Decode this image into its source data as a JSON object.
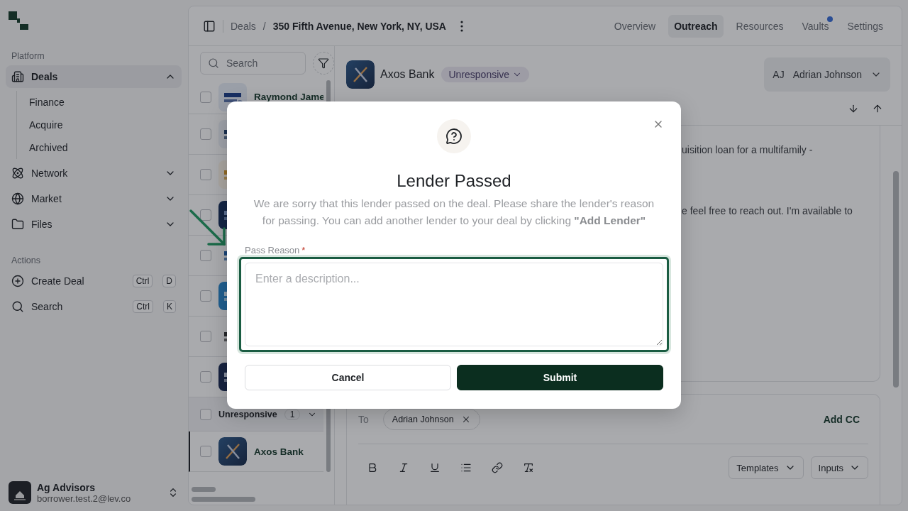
{
  "sidebar": {
    "sections": [
      {
        "title": "Platform",
        "items": [
          {
            "label": "Deals",
            "selected": true,
            "expanded": true,
            "children": [
              {
                "label": "Finance"
              },
              {
                "label": "Acquire"
              },
              {
                "label": "Archived"
              }
            ]
          },
          {
            "label": "Network",
            "selected": false,
            "expanded": false
          },
          {
            "label": "Market",
            "selected": false,
            "expanded": false
          },
          {
            "label": "Files",
            "selected": false,
            "expanded": false
          }
        ]
      },
      {
        "title": "Actions",
        "items": [
          {
            "label": "Create Deal",
            "shortcut": [
              "Ctrl",
              "D"
            ]
          },
          {
            "label": "Search",
            "shortcut": [
              "Ctrl",
              "K"
            ]
          }
        ]
      }
    ],
    "account": {
      "name": "Ag Advisors",
      "email": "borrower.test.2@lev.co"
    }
  },
  "breadcrumbs": [
    "Deals",
    "350 Fifth Avenue, New York, NY, USA"
  ],
  "breadcrumb_separator": "/",
  "tabs": [
    {
      "label": "Overview",
      "selected": false,
      "notification": false
    },
    {
      "label": "Outreach",
      "selected": true,
      "notification": false
    },
    {
      "label": "Resources",
      "selected": false,
      "notification": false
    },
    {
      "label": "Vaults",
      "selected": false,
      "notification": true
    },
    {
      "label": "Settings",
      "selected": false,
      "notification": false
    }
  ],
  "lender_list": {
    "search": {
      "placeholder": "Search"
    },
    "rows": [
      {
        "kind": "lender",
        "name": "Raymond Jame",
        "checked": false,
        "selected": false
      },
      {
        "kind": "lender",
        "checked": false,
        "selected": false
      },
      {
        "kind": "lender",
        "checked": false,
        "selected": false
      },
      {
        "kind": "lender",
        "checked": false,
        "selected": false
      },
      {
        "kind": "lender",
        "checked": false,
        "selected": false
      },
      {
        "kind": "lender",
        "checked": false,
        "selected": false
      },
      {
        "kind": "lender",
        "checked": false,
        "selected": false
      },
      {
        "kind": "lender",
        "checked": false,
        "selected": false
      },
      {
        "kind": "group",
        "name": "Unresponsive",
        "count": "1",
        "checked": false,
        "expanded": true
      },
      {
        "kind": "lender",
        "name": "Axos Bank",
        "checked": false,
        "selected": true
      }
    ]
  },
  "detail": {
    "lender": "Axos Bank",
    "status": "Unresponsive",
    "assignee": {
      "initials": "AJ",
      "name": "Adrian Johnson"
    },
    "message_lines": [
      "uisition loan for a multifamily -",
      "e feel free to reach out. I'm available to"
    ],
    "composer": {
      "to_label": "To",
      "recipients": [
        "Adrian Johnson"
      ],
      "add_cc": "Add CC",
      "menus": [
        "Templates",
        "Inputs"
      ]
    }
  },
  "modal": {
    "title": "Lender Passed",
    "description": "We are sorry that this lender passed on the deal. Please share the lender's reason for passing. You can add another lender to your deal by clicking **\"Add Lender\"**",
    "field": {
      "label": "Pass Reason",
      "required_mark": "*",
      "placeholder": "Enter a description..."
    },
    "buttons": [
      {
        "label": "Cancel",
        "kind": "secondary"
      },
      {
        "label": "Submit",
        "kind": "primary"
      }
    ]
  }
}
